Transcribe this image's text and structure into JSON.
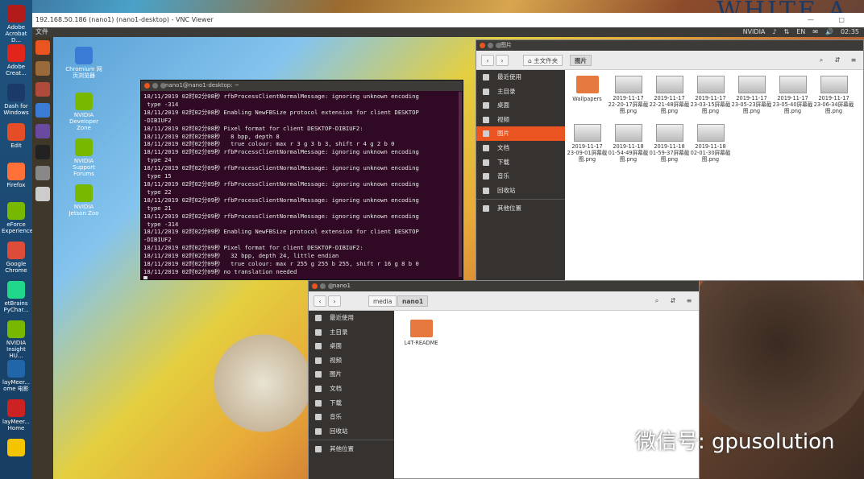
{
  "windows_desktop": {
    "icons": [
      {
        "label": "Adobe Acrobat D...",
        "color": "#b31b1b"
      },
      {
        "label": "Adobe Creat...",
        "color": "#e1251b"
      },
      {
        "label": "Dash for Windows",
        "color": "#1b3a6a"
      },
      {
        "label": "Edit",
        "color": "#e44d26"
      },
      {
        "label": "Firefox",
        "color": "#ff7139"
      },
      {
        "label": "eForce Experience",
        "color": "#76b900"
      },
      {
        "label": "Google Chrome",
        "color": "#dd4b39"
      },
      {
        "label": "etBrains PyChar...",
        "color": "#21d789"
      },
      {
        "label": "NVIDIA Insight HU...",
        "color": "#76b900"
      },
      {
        "label": "layMeer... ome 电影",
        "color": "#2266aa"
      },
      {
        "label": "layMeer... Home",
        "color": "#cc2222"
      },
      {
        "label": "",
        "color": "#f5c400"
      }
    ],
    "banner_text": "WHITE A"
  },
  "vnc": {
    "title": "192.168.50.186 (nano1) (nano1-desktop) - VNC Viewer",
    "controls": "—  □"
  },
  "topbar": {
    "menu": "文件",
    "tray": [
      "NVIDIA",
      "♪",
      "⇅",
      "EN",
      "✉",
      "🔊",
      "02:35"
    ]
  },
  "launcher": {
    "items": [
      {
        "name": "search",
        "color": "#e95420"
      },
      {
        "name": "files",
        "color": "#9a6a3a"
      },
      {
        "name": "settings",
        "color": "#b04a3a"
      },
      {
        "name": "chromium",
        "color": "#3a7bd5"
      },
      {
        "name": "emacs",
        "color": "#6a4aa0"
      },
      {
        "name": "terminal",
        "color": "#222"
      },
      {
        "name": "disk",
        "color": "#888"
      },
      {
        "name": "drive",
        "color": "#ccc"
      }
    ]
  },
  "desktop_icons": [
    {
      "label": "Chromium 网页浏览器",
      "color": "#3a7bd5"
    },
    {
      "label": "NVIDIA Developer Zone",
      "color": "#76b900"
    },
    {
      "label": "NVIDIA Support Forums",
      "color": "#76b900"
    },
    {
      "label": "NVIDIA Jetson Zoo",
      "color": "#76b900"
    }
  ],
  "terminal": {
    "title": "nano1@nano1-desktop: ~",
    "lines": [
      "18/11/2019 02时02分08秒 rfbProcessClientNormalMessage: ignoring unknown encoding",
      " type -314",
      "18/11/2019 02时02分08秒 Enabling NewFBSize protocol extension for client DESKTOP",
      "-DIBIUF2",
      "18/11/2019 02时02分08秒 Pixel format for client DESKTOP-DIBIUF2:",
      "18/11/2019 02时02分08秒   8 bpp, depth 8",
      "18/11/2019 02时02分08秒   true colour: max r 3 g 3 b 3, shift r 4 g 2 b 0",
      "18/11/2019 02时02分09秒 rfbProcessClientNormalMessage: ignoring unknown encoding",
      " type 24",
      "18/11/2019 02时02分09秒 rfbProcessClientNormalMessage: ignoring unknown encoding",
      " type 15",
      "18/11/2019 02时02分09秒 rfbProcessClientNormalMessage: ignoring unknown encoding",
      " type 22",
      "18/11/2019 02时02分09秒 rfbProcessClientNormalMessage: ignoring unknown encoding",
      " type 21",
      "18/11/2019 02时02分09秒 rfbProcessClientNormalMessage: ignoring unknown encoding",
      " type -314",
      "18/11/2019 02时02分09秒 Enabling NewFBSize protocol extension for client DESKTOP",
      "-DIBIUF2",
      "18/11/2019 02时02分09秒 Pixel format for client DESKTOP-DIBIUF2:",
      "18/11/2019 02时02分09秒   32 bpp, depth 24, little endian",
      "18/11/2019 02时02分09秒   true colour: max r 255 g 255 b 255, shift r 16 g 8 b 0",
      "18/11/2019 02时02分09秒 no translation needed"
    ]
  },
  "files_pictures": {
    "title": "图片",
    "crumbs": [
      "⌂ 主文件夹",
      "图片"
    ],
    "sidebar": [
      "最近使用",
      "主目录",
      "桌面",
      "视频",
      "图片",
      "文档",
      "下载",
      "音乐",
      "回收站",
      "其他位置"
    ],
    "selected": "图片",
    "items": [
      {
        "label": "Wallpapers",
        "folder": true
      },
      {
        "label": "2019-11-17 22-20-17屏幕截图.png",
        "folder": false
      },
      {
        "label": "2019-11-17 22-21-48屏幕截图.png",
        "folder": false
      },
      {
        "label": "2019-11-17 23-03-15屏幕截图.png",
        "folder": false
      },
      {
        "label": "2019-11-17 23-05-23屏幕截图.png",
        "folder": false
      },
      {
        "label": "2019-11-17 23-05-40屏幕截图.png",
        "folder": false
      },
      {
        "label": "2019-11-17 23-06-34屏幕截图.png",
        "folder": false
      },
      {
        "label": "2019-11-17 23-09-01屏幕截图.png",
        "folder": false
      },
      {
        "label": "2019-11-18 01-54-49屏幕截图.png",
        "folder": false
      },
      {
        "label": "2019-11-18 01-59-37屏幕截图.png",
        "folder": false
      },
      {
        "label": "2019-11-18 02-01-30屏幕截图.png",
        "folder": false
      }
    ]
  },
  "files_nano1": {
    "title": "nano1",
    "crumbs": [
      "media",
      "nano1"
    ],
    "sidebar": [
      "最近使用",
      "主目录",
      "桌面",
      "视频",
      "图片",
      "文档",
      "下载",
      "音乐",
      "回收站",
      "其他位置"
    ],
    "items": [
      {
        "label": "L4T-README",
        "folder": true
      }
    ]
  },
  "watermark": "微信号: gpusolution"
}
